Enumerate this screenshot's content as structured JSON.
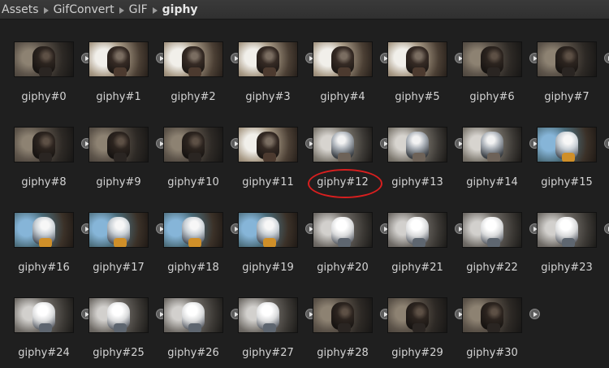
{
  "breadcrumb": {
    "items": [
      "Assets",
      "GifConvert",
      "GIF"
    ],
    "current": "giphy"
  },
  "assets": [
    {
      "label": "giphy#0",
      "style": "dark"
    },
    {
      "label": "giphy#1",
      "style": "warm"
    },
    {
      "label": "giphy#2",
      "style": "warm"
    },
    {
      "label": "giphy#3",
      "style": "warm"
    },
    {
      "label": "giphy#4",
      "style": "warm"
    },
    {
      "label": "giphy#5",
      "style": "warm"
    },
    {
      "label": "giphy#6",
      "style": "dark"
    },
    {
      "label": "giphy#7",
      "style": "dark"
    },
    {
      "label": "giphy#8",
      "style": "dark"
    },
    {
      "label": "giphy#9",
      "style": "dark"
    },
    {
      "label": "giphy#10",
      "style": "dark"
    },
    {
      "label": "giphy#11",
      "style": "warm"
    },
    {
      "label": "giphy#12",
      "style": "silver"
    },
    {
      "label": "giphy#13",
      "style": "silver"
    },
    {
      "label": "giphy#14",
      "style": "silver"
    },
    {
      "label": "giphy#15",
      "style": "blue"
    },
    {
      "label": "giphy#16",
      "style": "blue"
    },
    {
      "label": "giphy#17",
      "style": "blue"
    },
    {
      "label": "giphy#18",
      "style": "blue"
    },
    {
      "label": "giphy#19",
      "style": "blue"
    },
    {
      "label": "giphy#20",
      "style": "white"
    },
    {
      "label": "giphy#21",
      "style": "white"
    },
    {
      "label": "giphy#22",
      "style": "white"
    },
    {
      "label": "giphy#23",
      "style": "white"
    },
    {
      "label": "giphy#24",
      "style": "white"
    },
    {
      "label": "giphy#25",
      "style": "white"
    },
    {
      "label": "giphy#26",
      "style": "white"
    },
    {
      "label": "giphy#27",
      "style": "white"
    },
    {
      "label": "giphy#28",
      "style": "dark"
    },
    {
      "label": "giphy#29",
      "style": "dark"
    },
    {
      "label": "giphy#30",
      "style": "dark"
    }
  ],
  "highlighted_asset": "giphy#12",
  "colors": {
    "highlight": "#d71f1f",
    "play_icon": "#5d5d5d"
  }
}
